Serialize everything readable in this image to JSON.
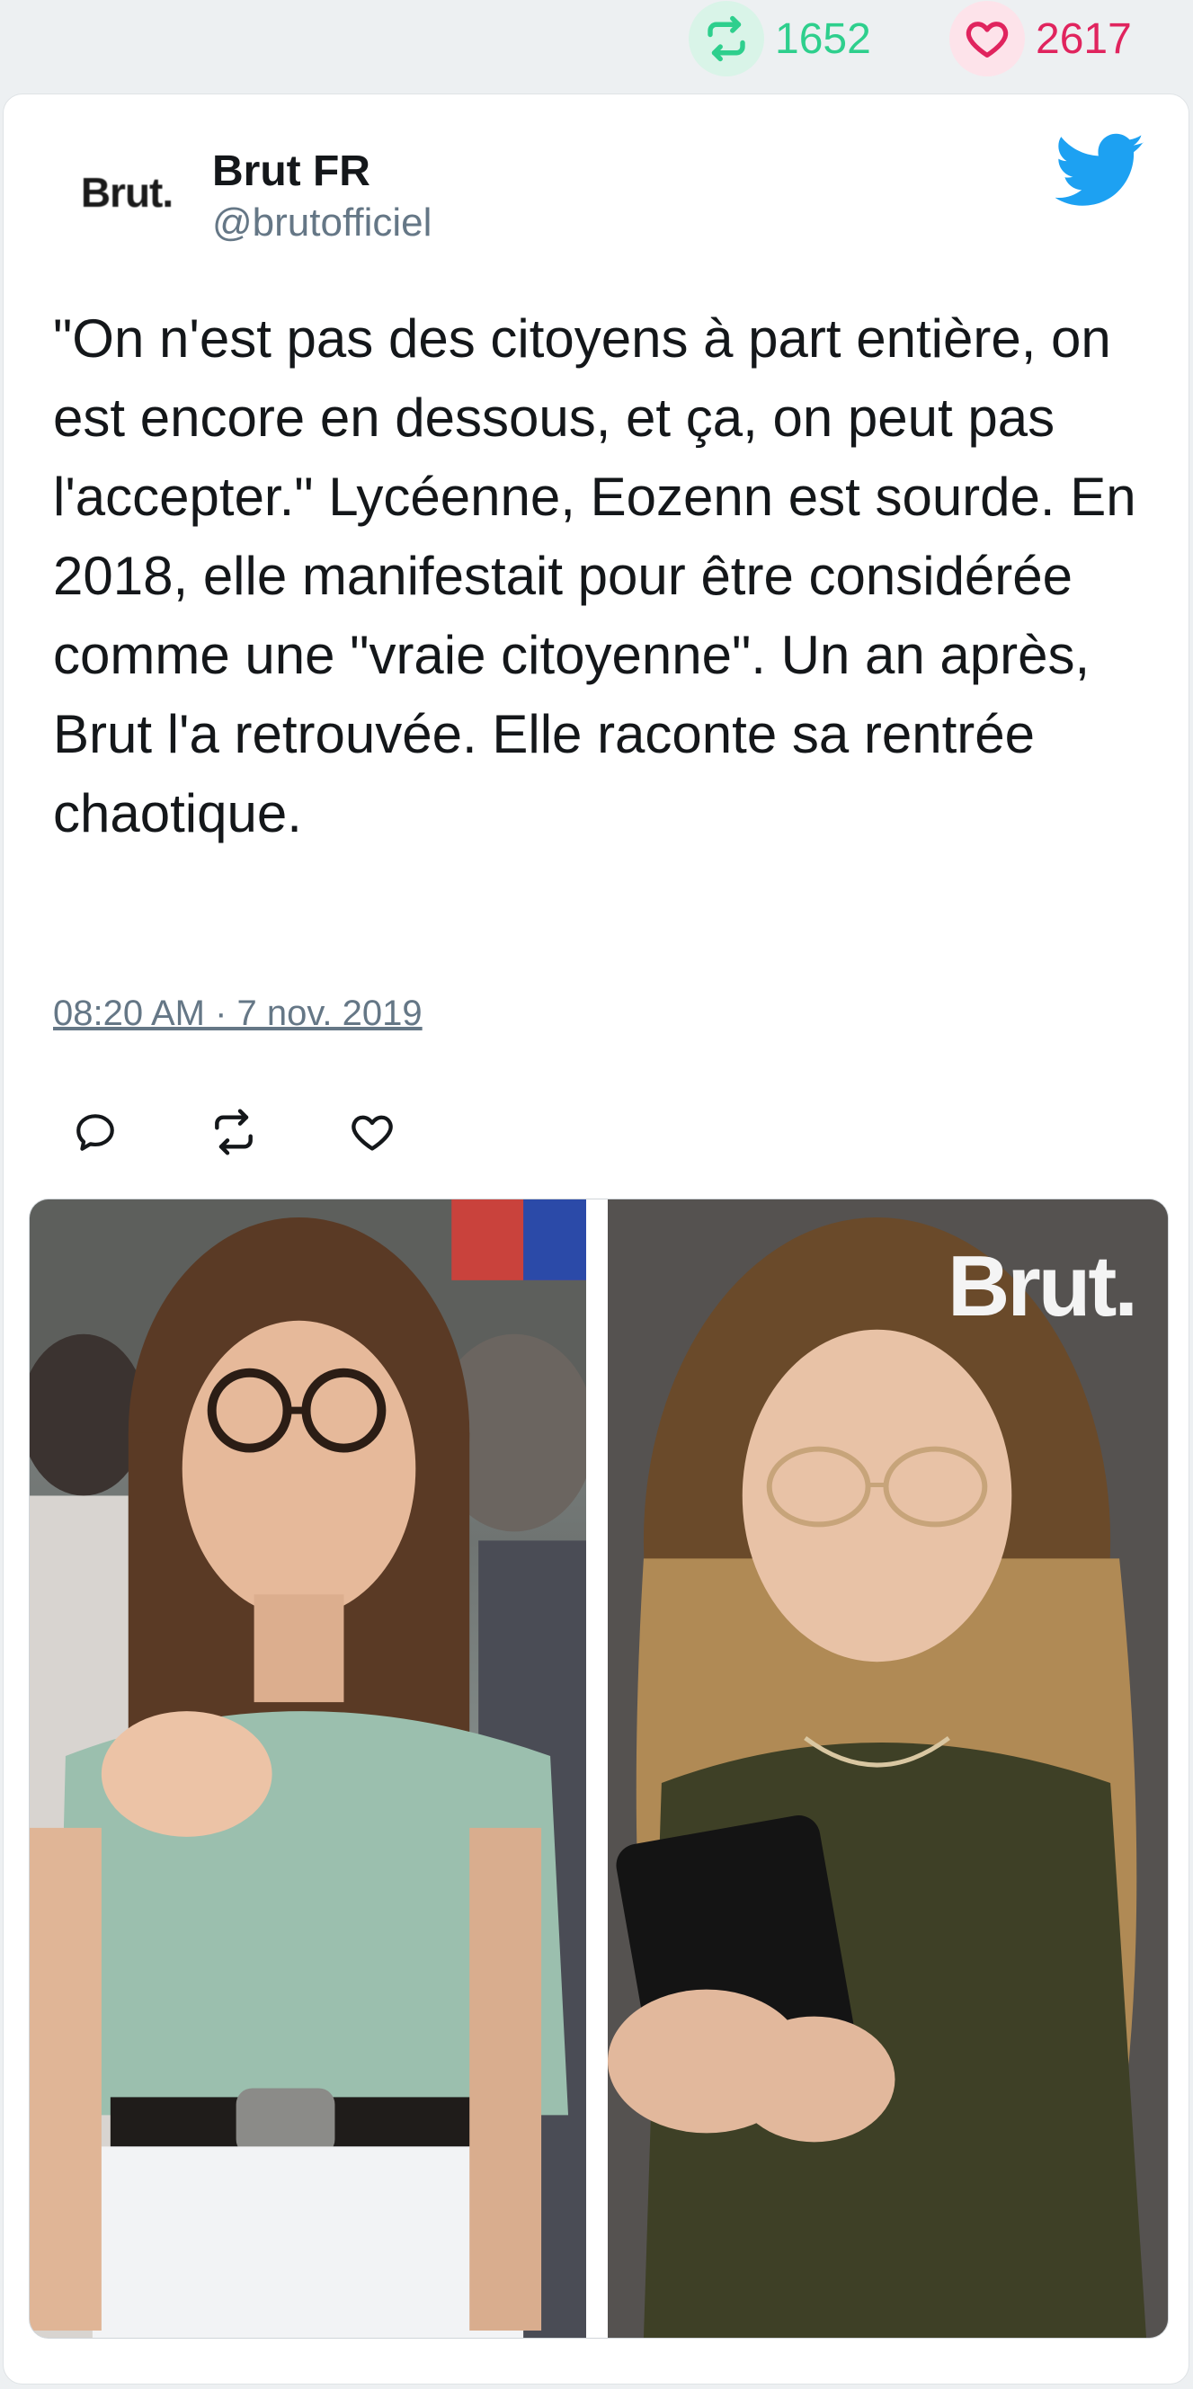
{
  "stats": {
    "retweets": "1652",
    "likes": "2617",
    "retweet_icon": "retweet-icon",
    "like_icon": "heart-icon",
    "retweet_color": "#2ecf8d",
    "like_color": "#e0245e"
  },
  "author": {
    "avatar_text": "Brut.",
    "name": "Brut FR",
    "handle": "@brutofficiel"
  },
  "tweet": {
    "text": "\"On n'est pas des citoyens à part entière, on est encore en dessous, et ça, on peut pas l'accepter.\" Lycéenne, Eozenn est sourde. En 2018, elle manifestait pour être considérée comme une \"vraie citoyenne\". Un an après, Brut l'a retrouvée. Elle raconte sa rentrée chaotique.",
    "timestamp": "08:20 AM · 7 nov. 2019"
  },
  "actions": [
    "reply-icon",
    "retweet-icon",
    "like-icon"
  ],
  "media": {
    "watermark": "Brut."
  },
  "colors": {
    "brand_bird": "#1da1f2",
    "text": "#14171a",
    "muted": "#657786"
  }
}
